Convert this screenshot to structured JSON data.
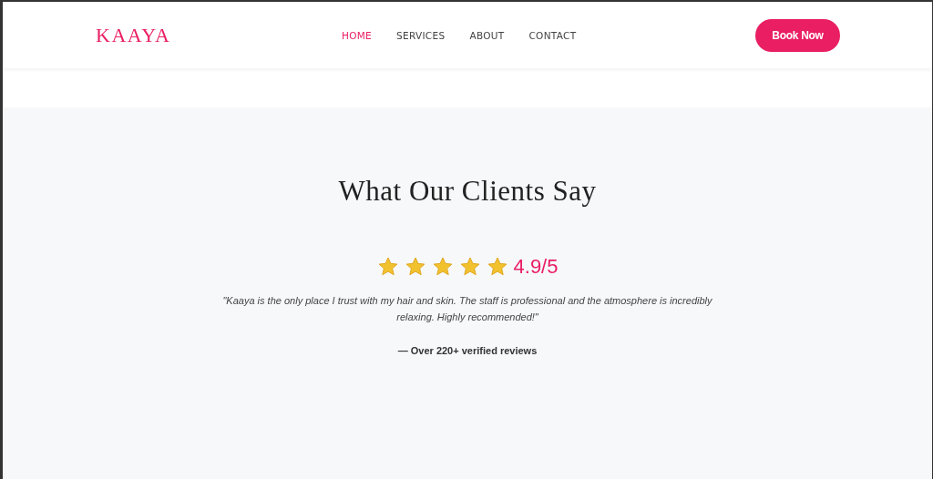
{
  "header": {
    "logo": "KAAYA",
    "nav": [
      {
        "label": "HOME",
        "selected": true
      },
      {
        "label": "SERVICES",
        "selected": false
      },
      {
        "label": "ABOUT",
        "selected": false
      },
      {
        "label": "CONTACT",
        "selected": false
      }
    ],
    "cta": "Book Now"
  },
  "testimonials": {
    "title": "What Our Clients Say",
    "stars": 5,
    "rating": "4.9/5",
    "quote": "\"Kaaya is the only place I trust with my hair and skin. The staff is professional and the atmosphere is incredibly relaxing. Highly recommended!\"",
    "attribution": "— Over 220+ verified reviews"
  }
}
